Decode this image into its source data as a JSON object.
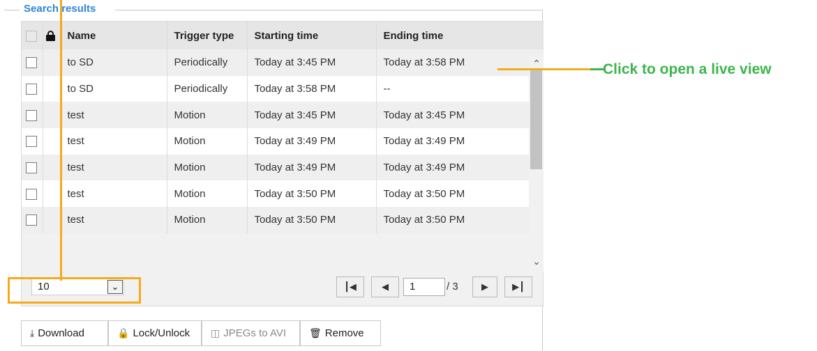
{
  "legend": "Search results",
  "table": {
    "headers": {
      "name": "Name",
      "trigger": "Trigger type",
      "start": "Starting time",
      "end": "Ending time"
    },
    "rows": [
      {
        "name": "to SD",
        "trigger": "Periodically",
        "start": "Today at 3:45 PM",
        "end": "Today at 3:58 PM"
      },
      {
        "name": "to SD",
        "trigger": "Periodically",
        "start": "Today at 3:58 PM",
        "end": "--"
      },
      {
        "name": "test",
        "trigger": "Motion",
        "start": "Today at 3:45 PM",
        "end": "Today at 3:45 PM"
      },
      {
        "name": "test",
        "trigger": "Motion",
        "start": "Today at 3:49 PM",
        "end": "Today at 3:49 PM"
      },
      {
        "name": "test",
        "trigger": "Motion",
        "start": "Today at 3:49 PM",
        "end": "Today at 3:49 PM"
      },
      {
        "name": "test",
        "trigger": "Motion",
        "start": "Today at 3:50 PM",
        "end": "Today at 3:50 PM"
      },
      {
        "name": "test",
        "trigger": "Motion",
        "start": "Today at 3:50 PM",
        "end": "Today at 3:50 PM"
      }
    ]
  },
  "page_size": {
    "selected": "10"
  },
  "pager": {
    "current_page": "1",
    "total": "/ 3"
  },
  "actions": {
    "download": "Download",
    "lock_unlock": "Lock/Unlock",
    "jpegs_to_avi": "JPEGs to AVI",
    "remove": "Remove"
  },
  "callout": "Click to open a live view",
  "colors": {
    "legend": "#2e86d6",
    "callout": "#3cb54a",
    "highlight": "#f5a91d"
  }
}
